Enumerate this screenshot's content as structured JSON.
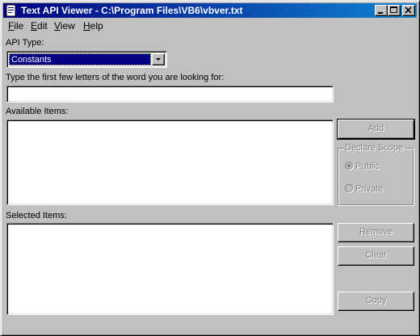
{
  "window": {
    "title": "Text API Viewer - C:\\Program Files\\VB6\\vbver.txt"
  },
  "menu": [
    {
      "label": "File",
      "accel": "F",
      "rest": "ile"
    },
    {
      "label": "Edit",
      "accel": "E",
      "rest": "dit"
    },
    {
      "label": "View",
      "accel": "V",
      "rest": "iew"
    },
    {
      "label": "Help",
      "accel": "H",
      "rest": "elp"
    }
  ],
  "api_type": {
    "label": "API Type:",
    "selected": "Constants"
  },
  "search": {
    "label": "Type the first few letters of the word you are looking for:",
    "value": ""
  },
  "available": {
    "label": "Available Items:",
    "items": []
  },
  "selected": {
    "label": "Selected Items:",
    "items": []
  },
  "buttons": {
    "add": "Add",
    "remove": "Remove",
    "clear": "Clear",
    "copy": "Copy"
  },
  "scope": {
    "label": "Declare Scope",
    "public": "Public",
    "private": "Private",
    "selected": "Public"
  },
  "colors": {
    "titlebar": "#000080",
    "face": "#c0c0c0",
    "disabled_text": "#808080"
  }
}
